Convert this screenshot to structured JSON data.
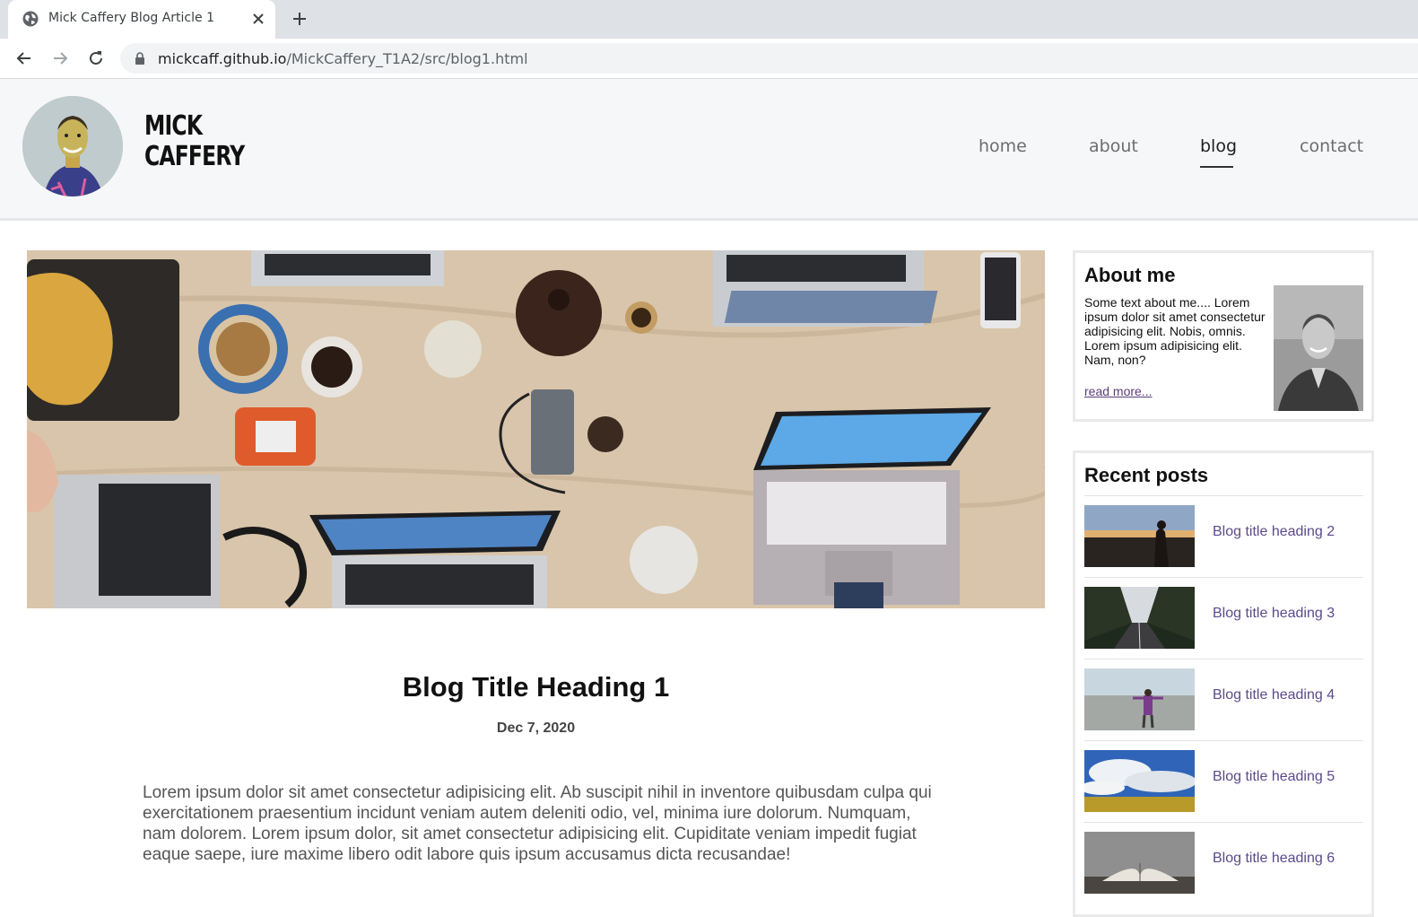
{
  "browser": {
    "tab_title": "Mick Caffery Blog Article 1",
    "url_host": "mickcaff.github.io",
    "url_path": "/MickCaffery_T1A2/src/blog1.html"
  },
  "site": {
    "brand_line1": "MICK",
    "brand_line2": "CAFFERY",
    "nav": [
      {
        "label": "home"
      },
      {
        "label": "about"
      },
      {
        "label": "blog"
      },
      {
        "label": "contact"
      }
    ]
  },
  "post": {
    "title": "Blog Title Heading 1",
    "date": "Dec 7, 2020",
    "body": "Lorem ipsum dolor sit amet consectetur adipisicing elit. Ab suscipit nihil in inventore quibusdam culpa qui exercitationem praesentium incidunt veniam autem deleniti odio, vel, minima iure dolorum. Numquam, nam dolorem. Lorem ipsum dolor, sit amet consectetur adipisicing elit. Cupiditate veniam impedit fugiat eaque saepe, iure maxime libero odit labore quis ipsum accusamus dicta recusandae!"
  },
  "sidebar": {
    "about_title": "About me",
    "about_text": "Some text about me.... Lorem ipsum dolor sit amet consectetur adipisicing elit. Nobis, omnis. Lorem ipsum adipisicing elit. Nam, non?",
    "about_link": "read more...",
    "recent_title": "Recent posts",
    "recent": [
      {
        "label": "Blog title heading 2"
      },
      {
        "label": "Blog title heading 3"
      },
      {
        "label": "Blog title heading 4"
      },
      {
        "label": "Blog title heading 5"
      },
      {
        "label": "Blog title heading 6"
      }
    ]
  },
  "colors": {
    "accent_link": "#5b4a8a",
    "header_bg": "#f6f7f9"
  }
}
